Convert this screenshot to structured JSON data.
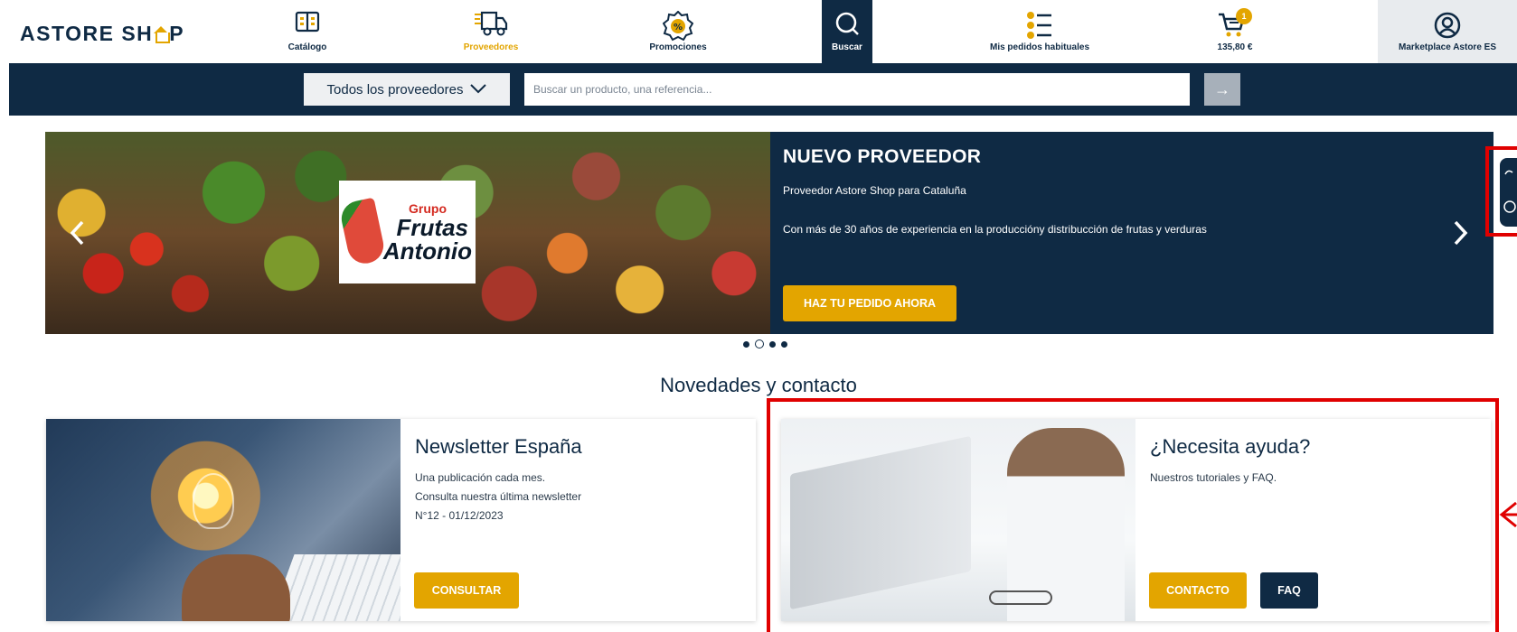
{
  "header": {
    "logo": "ASTORE SHOP",
    "logo_prefix": "ASTORE SH",
    "logo_suffix": "P",
    "nav": [
      {
        "label": "Catálogo",
        "icon": "catalog-book-icon"
      },
      {
        "label": "Proveedores",
        "icon": "delivery-truck-icon"
      },
      {
        "label": "Promociones",
        "icon": "percent-badge-icon"
      },
      {
        "label": "Buscar",
        "icon": "search-icon"
      },
      {
        "label": "Mis pedidos habituales",
        "icon": "list-icon"
      },
      {
        "label": "135,80 €",
        "icon": "cart-icon",
        "badge": "1"
      },
      {
        "label": "Marketplace Astore ES",
        "icon": "user-icon"
      }
    ]
  },
  "search": {
    "provider_select": "Todos los proveedores",
    "placeholder": "Buscar un producto, una referencia...",
    "submit": "→"
  },
  "hero": {
    "logo_line1": "Grupo",
    "logo_line2": "Frutas",
    "logo_line3": "Antonio",
    "title": "NUEVO PROVEEDOR",
    "subtitle": "Proveedor Astore Shop para Cataluña",
    "description": "Con más de 30 años de experiencia en la produccióny distribucción de frutas y verduras",
    "cta": "HAZ TU PEDIDO AHORA",
    "prev": "‹",
    "next": "›",
    "slides": 4,
    "active_slide": 2
  },
  "section": {
    "title": "Novedades y contacto"
  },
  "cards": {
    "newsletter": {
      "title": "Newsletter España",
      "line1": "Una publicación cada mes.",
      "line2": "Consulta nuestra última newsletter",
      "line3": "N°12 - 01/12/2023",
      "button": "CONSULTAR"
    },
    "help": {
      "title": "¿Necesita ayuda?",
      "line1": "Nuestros tutoriales y FAQ.",
      "button_contact": "CONTACTO",
      "button_faq": "FAQ"
    }
  },
  "colors": {
    "navy": "#0f2a44",
    "accent": "#e3a500",
    "highlight": "#e00000"
  }
}
